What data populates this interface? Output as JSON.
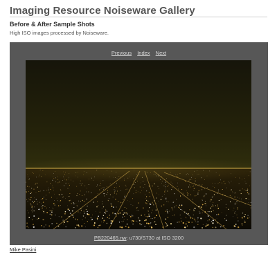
{
  "page": {
    "title": "Imaging Resource Noiseware Gallery",
    "heading": "Before & After Sample Shots",
    "description": "High ISO images processed by Noiseware."
  },
  "gallery": {
    "nav": {
      "previous_label": "Previous",
      "index_label": "Index",
      "next_label": "Next"
    },
    "photo": {
      "description": "Night view of city lights under a dark green-yellow sky"
    },
    "caption": {
      "file_link": "PB220465.nw",
      "details": ": u730/S730 at ISO 3200"
    }
  },
  "footer": {
    "author": "Mike Pasini"
  },
  "colors": {
    "frame": "#575757",
    "sky_top": "#1b1a05",
    "sky_bottom": "#3a3a10"
  }
}
